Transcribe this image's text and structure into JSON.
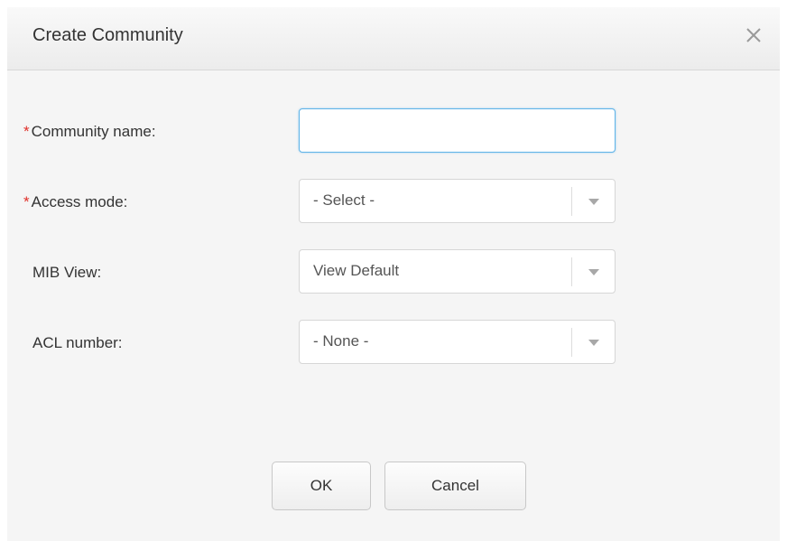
{
  "dialog": {
    "title": "Create Community",
    "close_icon": "close-icon"
  },
  "form": {
    "community_name": {
      "required": "*",
      "label": "Community name:",
      "value": "",
      "placeholder": ""
    },
    "access_mode": {
      "required": "*",
      "label": "Access mode:",
      "selected": "- Select -",
      "icon": "chevron-down-icon"
    },
    "mib_view": {
      "label": "MIB View:",
      "selected": "View Default",
      "icon": "chevron-down-icon"
    },
    "acl_number": {
      "label": "ACL number:",
      "selected": "- None -",
      "icon": "chevron-down-icon"
    }
  },
  "buttons": {
    "ok_label": "OK",
    "cancel_label": "Cancel"
  },
  "colors": {
    "required_marker": "#e0302a",
    "focus_border": "#5fb3e8",
    "dialog_background": "#f5f5f5"
  }
}
